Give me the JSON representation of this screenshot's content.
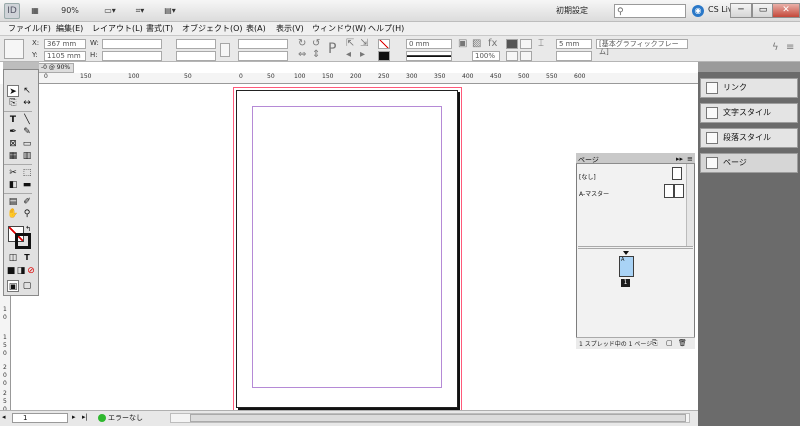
{
  "appbar": {
    "logo": "ID",
    "zoom": "90%",
    "workspace": "初期設定",
    "search_placeholder": "",
    "cslive": "CS Live",
    "minimize": "─",
    "maximize": "▭",
    "close": "✕"
  },
  "menus": [
    "ファイル(F)",
    "編集(E)",
    "レイアウト(L)",
    "書式(T)",
    "オブジェクト(O)",
    "表(A)",
    "表示(V)",
    "ウィンドウ(W)",
    "ヘルプ(H)"
  ],
  "control": {
    "x_label": "X:",
    "x_value": "367 mm",
    "y_label": "Y:",
    "y_value": "1105 mm",
    "w_label": "W:",
    "h_label": "H:",
    "stroke_weight": "0 mm",
    "opacity": "100%",
    "frame_dim": "5 mm",
    "object_style": "[基本グラフィックフレーム]"
  },
  "document": {
    "tab": "-0 @ 90%"
  },
  "ruler_h": [
    "0",
    "150",
    "100",
    "50",
    "0",
    "50",
    "100",
    "150",
    "200",
    "250",
    "300",
    "350",
    "400",
    "450",
    "500",
    "550",
    "600"
  ],
  "ruler_v": [
    "0",
    "1",
    "0",
    "1",
    "5",
    "0",
    "2",
    "0",
    "0",
    "2",
    "5",
    "0"
  ],
  "status": {
    "page": "1",
    "preflight": "エラーなし"
  },
  "dock": {
    "items": [
      "リンク",
      "文字スタイル",
      "段落スタイル",
      "ページ"
    ]
  },
  "pages_panel": {
    "tab": "ページ",
    "master_none": "[なし]",
    "master_a": "A-マスター",
    "page_label": "A",
    "page_number": "1",
    "status": "1 スプレッド中の 1 ページ"
  }
}
